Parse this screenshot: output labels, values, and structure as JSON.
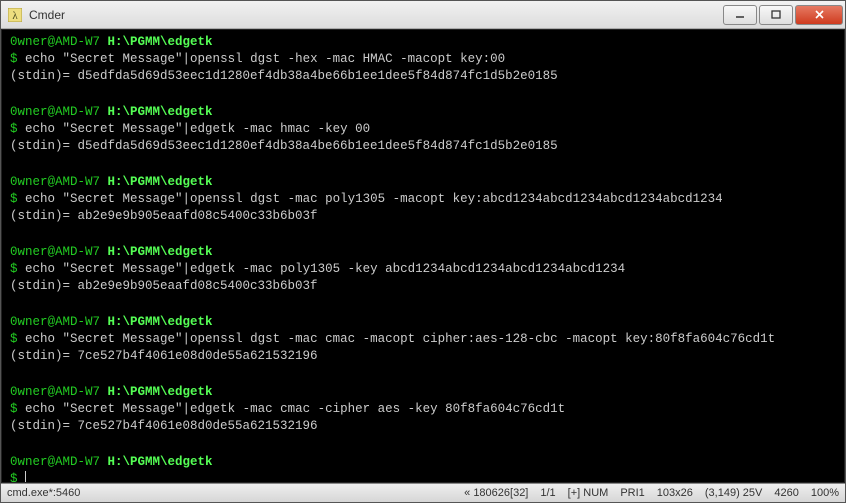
{
  "window": {
    "title": "Cmder",
    "icon_name": "lambda-icon"
  },
  "prompt": {
    "user": "0wner@AMD-W7",
    "path": "H:\\PGMM\\edgetk",
    "symbol": "$"
  },
  "entries": [
    {
      "command": "echo \"Secret Message\"|openssl dgst -hex -mac HMAC -macopt key:00",
      "output": "(stdin)= d5edfda5d69d53eec1d1280ef4db38a4be66b1ee1dee5f84d874fc1d5b2e0185"
    },
    {
      "command": "echo \"Secret Message\"|edgetk -mac hmac -key 00",
      "output": "(stdin)= d5edfda5d69d53eec1d1280ef4db38a4be66b1ee1dee5f84d874fc1d5b2e0185"
    },
    {
      "command": "echo \"Secret Message\"|openssl dgst -mac poly1305 -macopt key:abcd1234abcd1234abcd1234abcd1234",
      "output": "(stdin)= ab2e9e9b905eaafd08c5400c33b6b03f"
    },
    {
      "command": "echo \"Secret Message\"|edgetk -mac poly1305 -key abcd1234abcd1234abcd1234abcd1234",
      "output": "(stdin)= ab2e9e9b905eaafd08c5400c33b6b03f"
    },
    {
      "command": "echo \"Secret Message\"|openssl dgst -mac cmac -macopt cipher:aes-128-cbc -macopt key:80f8fa604c76cd1t",
      "output": "(stdin)= 7ce527b4f4061e08d0de55a621532196"
    },
    {
      "command": "echo \"Secret Message\"|edgetk -mac cmac -cipher aes -key 80f8fa604c76cd1t",
      "output": "(stdin)= 7ce527b4f4061e08d0de55a621532196"
    }
  ],
  "statusbar": {
    "left": "cmd.exe*:5460",
    "console_size": "« 180626[32]",
    "pages": "1/1",
    "caps": "[+] NUM",
    "pri": "PRI1",
    "dim": "103x26",
    "cursor": "(3,149) 25V",
    "mem": "4260",
    "zoom": "100%"
  }
}
